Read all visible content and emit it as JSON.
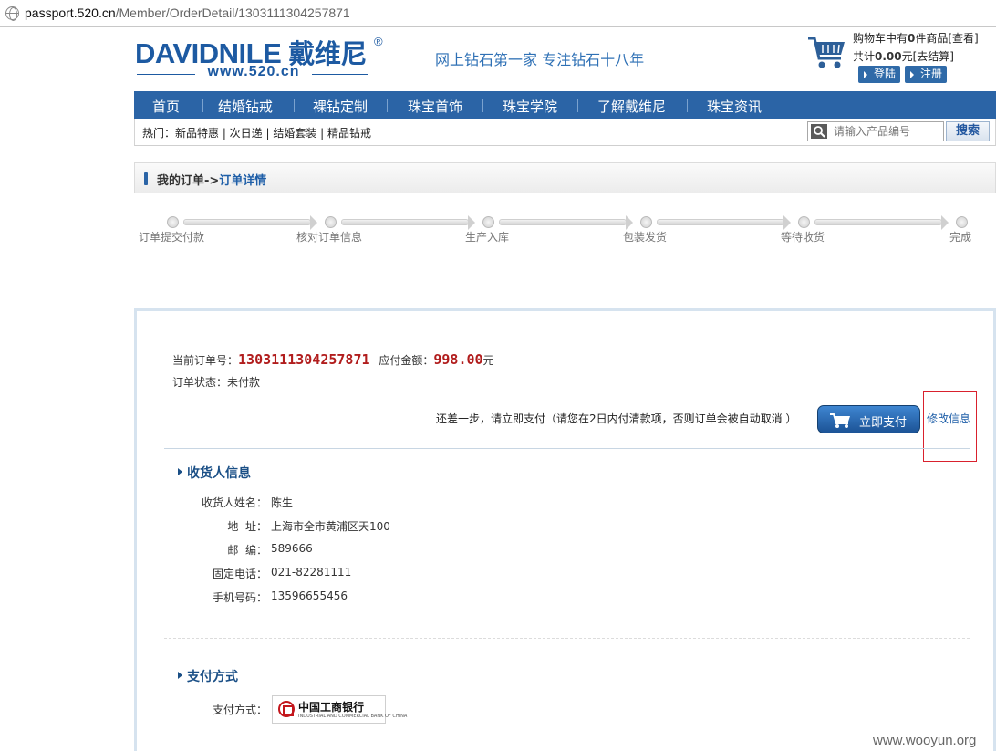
{
  "browser": {
    "url_host": "passport.520.cn",
    "url_path": "/Member/OrderDetail/1303111304257871"
  },
  "header": {
    "logo_text": "DAVIDNILE",
    "logo_cn": "戴维尼",
    "logo_reg": "®",
    "logo_www": "www.520.cn",
    "slogan": "网上钻石第一家 专注钻石十八年",
    "cart_prefix": "购物车中有",
    "cart_count": "0",
    "cart_suffix": "件商品[查看]",
    "total_prefix": "共计",
    "total_amount": "0.00",
    "total_suffix": "元[去结算]",
    "login_label": "登陆",
    "register_label": "注册"
  },
  "nav": {
    "items": [
      "首页",
      "结婚钻戒",
      "裸钻定制",
      "珠宝首饰",
      "珠宝学院",
      "了解戴维尼",
      "珠宝资讯"
    ]
  },
  "hotbar": {
    "text": "热门：新品特惠 | 次日递 | 结婚套装 | 精品钻戒",
    "search_placeholder": "请输入产品编号",
    "search_label": "搜索"
  },
  "breadcrumb": {
    "parent": "我的订单->",
    "current": "订单详情"
  },
  "steps": [
    "订单提交付款",
    "核对订单信息",
    "生产入库",
    "包装发货",
    "等待收货",
    "完成"
  ],
  "order": {
    "number_label": "当前订单号：",
    "number": "1303111304257871",
    "amount_label": "应付金额：",
    "amount": "998.00",
    "amount_unit": "元",
    "status": "订单状态：未付款",
    "pay_hint": "还差一步，请立即支付（请您在2日内付清款项，否则订单会被自动取消 ）",
    "pay_button": "立即支付",
    "edit_link": "修改信息"
  },
  "consignee": {
    "title": "收货人信息",
    "rows": [
      {
        "label": "收货人姓名：",
        "value": "陈生"
      },
      {
        "label": "地  址：",
        "value": "上海市全市黄浦区天100"
      },
      {
        "label": "邮  编：",
        "value": "589666"
      },
      {
        "label": "固定电话：",
        "value": "021-82281111"
      },
      {
        "label": "手机号码：",
        "value": "13596655456"
      }
    ]
  },
  "payment": {
    "title": "支付方式",
    "label": "支付方式：",
    "bank_name": "中国工商银行",
    "bank_en": "INDUSTRIAL AND COMMERCIAL BANK OF CHINA"
  },
  "watermark": "www.wooyun.org",
  "colors": {
    "brand_blue": "#2b64a6",
    "price_red": "#b11d1d",
    "highlight_box": "#d9212d"
  }
}
